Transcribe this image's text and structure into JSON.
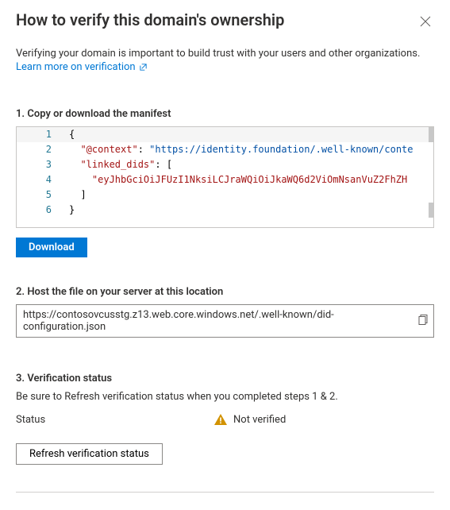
{
  "title": "How to verify this domain's ownership",
  "intro": "Verifying your domain is important to build trust with your users and other organizations.",
  "learnMore": "Learn more on verification",
  "step1": {
    "title": "1. Copy or download the manifest",
    "download": "Download",
    "code": {
      "l1": "{",
      "l2a": "\"@context\"",
      "l2b": ": ",
      "l2c": "\"https://identity.foundation/.well-known/conte",
      "l3a": "\"linked_dids\"",
      "l3b": ": [",
      "l4": "\"eyJhbGciOiJFUzI1NksiLCJraWQiOiJkaWQ6d2ViOmNsanVuZ2FhZH",
      "l5": "]",
      "l6": "}"
    }
  },
  "step2": {
    "title": "2. Host the file on your server at this location",
    "url": "https://contosovcusstg.z13.web.core.windows.net/.well-known/did-configuration.json"
  },
  "step3": {
    "title": "3. Verification status",
    "hint": "Be sure to Refresh verification status when you completed steps 1 & 2.",
    "statusLabel": "Status",
    "statusValue": "Not verified",
    "refresh": "Refresh verification status"
  }
}
